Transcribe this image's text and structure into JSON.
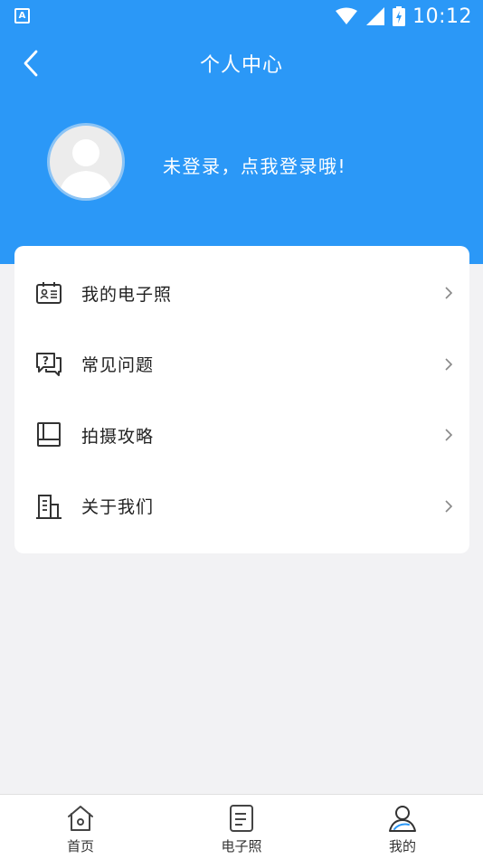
{
  "status_bar": {
    "app_badge": "A",
    "time": "10:12",
    "icons": [
      "wifi-icon",
      "signal-icon",
      "battery-icon"
    ]
  },
  "header": {
    "title": "个人中心",
    "back_icon": "chevron-left-icon",
    "login_prompt": "未登录，点我登录哦!",
    "avatar_icon": "user-silhouette-icon"
  },
  "menu": {
    "items": [
      {
        "label": "我的电子照",
        "icon": "id-card-icon"
      },
      {
        "label": "常见问题",
        "icon": "question-bubble-icon"
      },
      {
        "label": "拍摄攻略",
        "icon": "book-icon"
      },
      {
        "label": "关于我们",
        "icon": "building-icon"
      }
    ]
  },
  "tab_bar": {
    "tabs": [
      {
        "label": "首页",
        "icon": "home-icon"
      },
      {
        "label": "电子照",
        "icon": "document-icon"
      },
      {
        "label": "我的",
        "icon": "profile-icon",
        "active": true
      }
    ]
  },
  "colors": {
    "primary": "#2b98f7",
    "background": "#f2f2f4",
    "card": "#ffffff",
    "text": "#222222"
  }
}
